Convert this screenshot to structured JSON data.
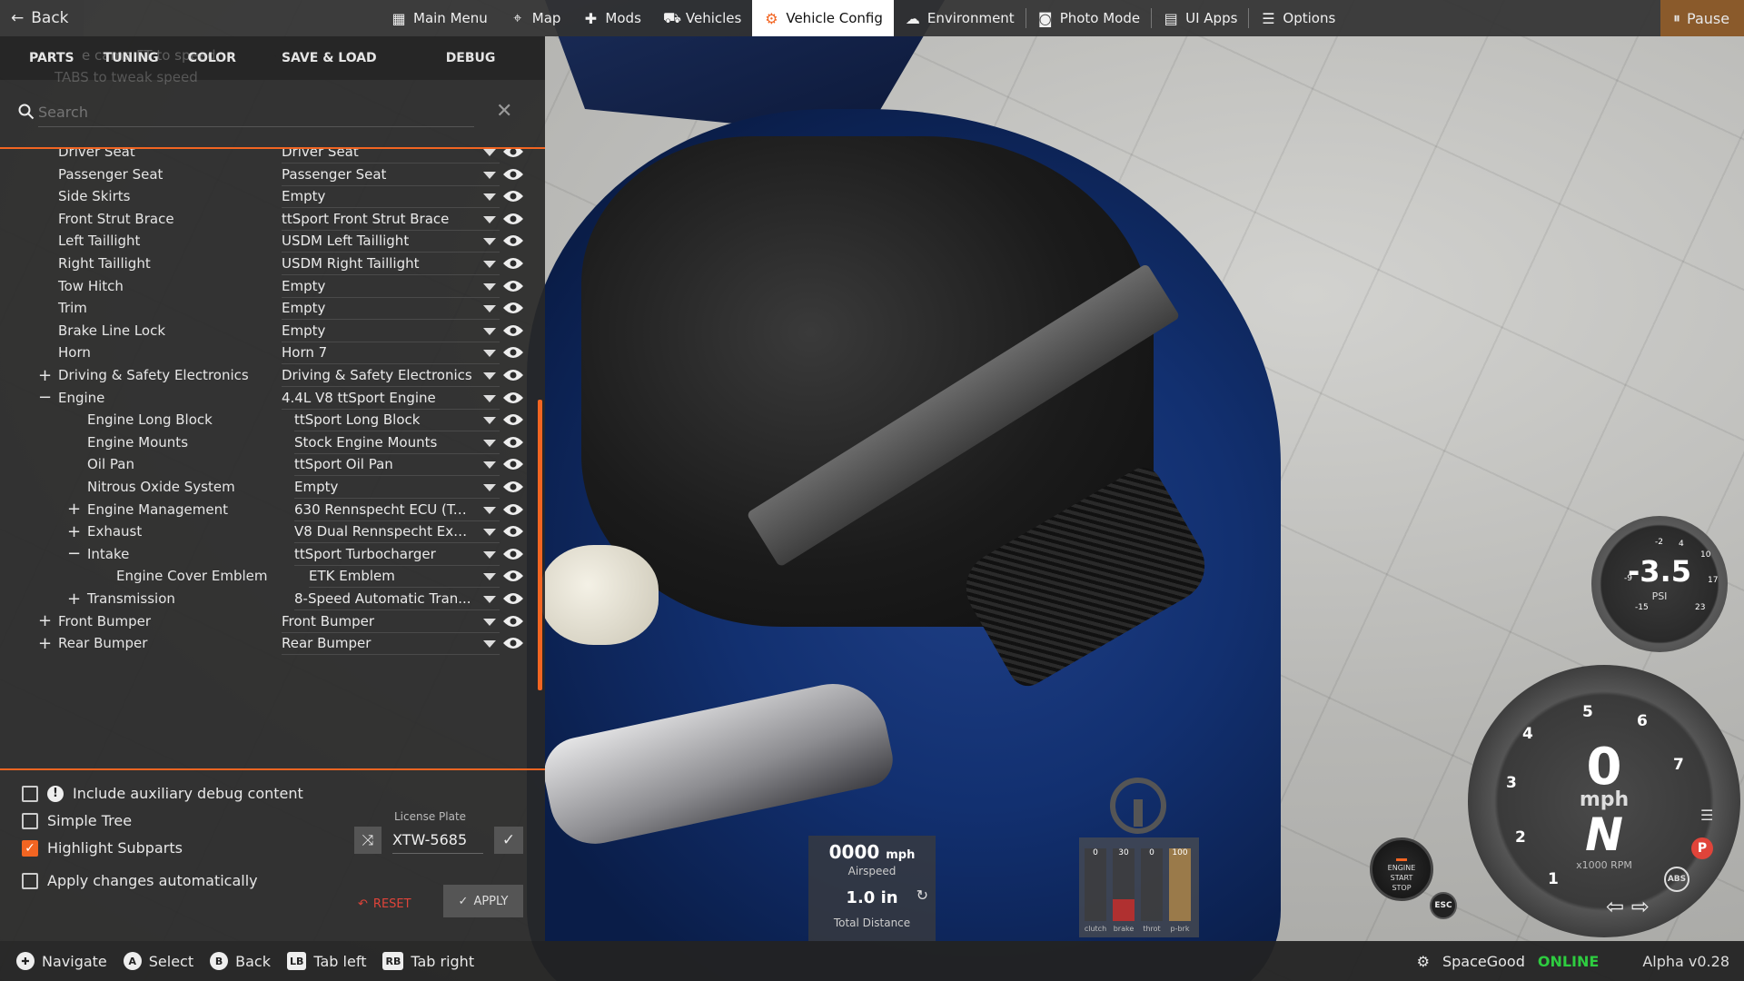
{
  "topbar": {
    "back_label": "Back",
    "nav": [
      {
        "label": "Main Menu",
        "icon": "main-menu-icon",
        "glyph": "▦",
        "active": false
      },
      {
        "label": "Map",
        "icon": "map-icon",
        "glyph": "⌖",
        "active": false
      },
      {
        "label": "Mods",
        "icon": "puzzle-icon",
        "glyph": "✚",
        "active": false
      },
      {
        "label": "Vehicles",
        "icon": "car-icon",
        "glyph": "⛟",
        "active": false
      },
      {
        "label": "Vehicle Config",
        "icon": "engine-icon",
        "glyph": "⚙",
        "active": true
      },
      {
        "label": "Environment",
        "icon": "weather-icon",
        "glyph": "☁",
        "active": false
      },
      {
        "label": "Photo Mode",
        "icon": "camera-icon",
        "glyph": "◙",
        "active": false
      },
      {
        "label": "UI Apps",
        "icon": "ui-apps-icon",
        "glyph": "▤",
        "active": false
      },
      {
        "label": "Options",
        "icon": "options-icon",
        "glyph": "☰",
        "active": false
      }
    ],
    "pause_label": "Pause"
  },
  "panel": {
    "tabs": [
      "PARTS",
      "TUNING",
      "COLOR",
      "SAVE & LOAD",
      "DEBUG"
    ],
    "ghost_hint_1": "e came          FT to      speed,",
    "ghost_hint_2": "         TABS to tweak speed",
    "search_placeholder": "Search",
    "tree": [
      {
        "label": "Driver Seat",
        "value": "Driver Seat",
        "depth": 1,
        "expander": ""
      },
      {
        "label": "Passenger Seat",
        "value": "Passenger Seat",
        "depth": 1,
        "expander": ""
      },
      {
        "label": "Side Skirts",
        "value": "Empty",
        "depth": 1,
        "expander": ""
      },
      {
        "label": "Front Strut Brace",
        "value": "ttSport Front Strut Brace",
        "depth": 1,
        "expander": ""
      },
      {
        "label": "Left Taillight",
        "value": "USDM Left Taillight",
        "depth": 1,
        "expander": ""
      },
      {
        "label": "Right Taillight",
        "value": "USDM Right Taillight",
        "depth": 1,
        "expander": ""
      },
      {
        "label": "Tow Hitch",
        "value": "Empty",
        "depth": 1,
        "expander": ""
      },
      {
        "label": "Trim",
        "value": "Empty",
        "depth": 1,
        "expander": ""
      },
      {
        "label": "Brake Line Lock",
        "value": "Empty",
        "depth": 1,
        "expander": ""
      },
      {
        "label": "Horn",
        "value": "Horn 7",
        "depth": 1,
        "expander": ""
      },
      {
        "label": "Driving & Safety Electronics",
        "value": "Driving & Safety Electronics",
        "depth": 1,
        "expander": "+"
      },
      {
        "label": "Engine",
        "value": "4.4L V8 ttSport Engine",
        "depth": 1,
        "expander": "−"
      },
      {
        "label": "Engine Long Block",
        "value": "ttSport Long Block",
        "depth": 2,
        "expander": ""
      },
      {
        "label": "Engine Mounts",
        "value": "Stock Engine Mounts",
        "depth": 2,
        "expander": ""
      },
      {
        "label": "Oil Pan",
        "value": "ttSport Oil Pan",
        "depth": 2,
        "expander": ""
      },
      {
        "label": "Nitrous Oxide System",
        "value": "Empty",
        "depth": 2,
        "expander": ""
      },
      {
        "label": "Engine Management",
        "value": "630 Rennspecht ECU (Tu...",
        "depth": 2,
        "expander": "+"
      },
      {
        "label": "Exhaust",
        "value": "V8 Dual Rennspecht Exh...",
        "depth": 2,
        "expander": "+"
      },
      {
        "label": "Intake",
        "value": "ttSport Turbocharger",
        "depth": 2,
        "expander": "−"
      },
      {
        "label": "Engine Cover Emblem",
        "value": "ETK Emblem",
        "depth": 3,
        "expander": ""
      },
      {
        "label": "Transmission",
        "value": "8-Speed Automatic Tran...",
        "depth": 2,
        "expander": "+"
      },
      {
        "label": "Front Bumper",
        "value": "Front Bumper",
        "depth": 1,
        "expander": "+"
      },
      {
        "label": "Rear Bumper",
        "value": "Rear Bumper",
        "depth": 1,
        "expander": "+"
      }
    ],
    "options": [
      {
        "label": "Include auxiliary debug content",
        "checked": false,
        "warn": true
      },
      {
        "label": "Simple Tree",
        "checked": false,
        "warn": false
      },
      {
        "label": "Highlight Subparts",
        "checked": true,
        "warn": false
      },
      {
        "label": "Apply changes automatically",
        "checked": false,
        "warn": false
      }
    ],
    "license_plate_label": "License Plate",
    "license_plate_value": "XTW-5685",
    "reset_label": "RESET",
    "apply_label": "APPLY"
  },
  "bottombar": {
    "hints": [
      {
        "glyph": "✚",
        "label": "Navigate",
        "icon": "dpad-icon"
      },
      {
        "glyph": "A",
        "label": "Select",
        "icon": "a-button-icon"
      },
      {
        "glyph": "B",
        "label": "Back",
        "icon": "b-button-icon"
      },
      {
        "glyph": "LB",
        "label": "Tab left",
        "icon": "lb-button-icon"
      },
      {
        "glyph": "RB",
        "label": "Tab right",
        "icon": "rb-button-icon"
      }
    ],
    "username": "SpaceGood",
    "status": "ONLINE",
    "version": "Alpha v0.28"
  },
  "hud": {
    "airspeed_value": "0000",
    "airspeed_unit": "mph",
    "airspeed_label": "Airspeed",
    "distance_value": "1.0 in",
    "distance_label": "Total Distance",
    "pedals": [
      {
        "name": "clutch",
        "value": "0",
        "fraction": 0,
        "color": "#888888"
      },
      {
        "name": "brake",
        "value": "30",
        "fraction": 0.3,
        "color": "#b03030"
      },
      {
        "name": "throt",
        "value": "0",
        "fraction": 0,
        "color": "#3a9a3a"
      },
      {
        "name": "p-brk",
        "value": "100",
        "fraction": 1.0,
        "color": "#9a7a4a"
      }
    ],
    "start_stop_lines": [
      "ENGINE",
      "START",
      "STOP"
    ],
    "esc_label": "ESC",
    "boost_value": "-3.5",
    "boost_unit": "PSI",
    "boost_ticks": [
      "-2",
      "4",
      "10",
      "-9",
      "17",
      "-15",
      "23"
    ],
    "gear_value": "0",
    "tacho_unit": "mph",
    "tacho_speed": "N",
    "rpm_label": "x1000 RPM",
    "tacho_numbers": [
      "1",
      "2",
      "3",
      "4",
      "5",
      "6",
      "7"
    ],
    "park_label": "P",
    "abs_label": "ABS"
  },
  "colors": {
    "accent": "#f26522",
    "online": "#2ecc40",
    "reset": "#e0443a"
  }
}
